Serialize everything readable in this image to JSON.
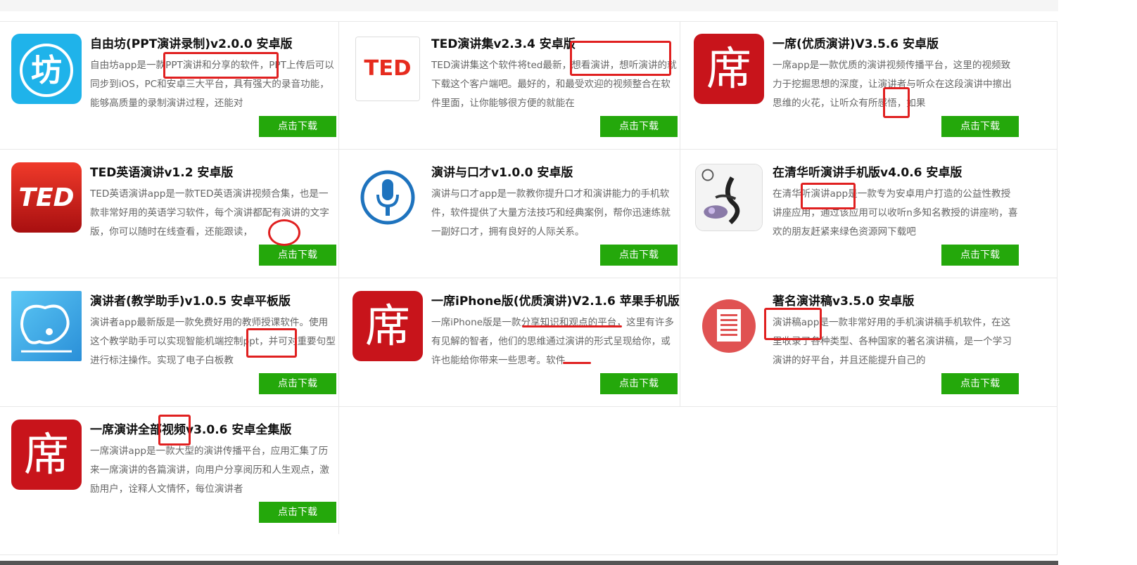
{
  "apps": [
    {
      "title": "自由坊(PPT演讲录制)v2.0.0 安卓版",
      "desc": "自由坊app是一款PPT演讲和分享的软件，PPT上传后可以同步到iOS，PC和安卓三大平台，具有强大的录音功能，能够高质量的录制演讲过程，还能对",
      "icon": "ziyoufang-icon",
      "button": "点击下载"
    },
    {
      "title": "TED演讲集v2.3.4 安卓版",
      "desc": "TED演讲集这个软件将ted最新，想看演讲，想听演讲的就下载这个客户端吧。最好的，和最受欢迎的视频整合在软件里面，让你能够很方便的就能在",
      "icon": "ted-icon",
      "button": "点击下载"
    },
    {
      "title": "一席(优质演讲)V3.5.6 安卓版",
      "desc": "一席app是一款优质的演讲视频传播平台，这里的视频致力于挖掘思想的深度，让演讲者与听众在这段演讲中擦出思维的火花，让听众有所感悟，如果",
      "icon": "yixi-icon",
      "button": "点击下载"
    },
    {
      "title": "TED英语演讲v1.2 安卓版",
      "desc": "TED英语演讲app是一款TED英语演讲视频合集，也是一款非常好用的英语学习软件，每个演讲都配有演讲的文字版，你可以随时在线查看，还能跟读，",
      "icon": "ted-english-icon",
      "button": "点击下载"
    },
    {
      "title": "演讲与口才v1.0.0 安卓版",
      "desc": "演讲与口才app是一款教你提升口才和演讲能力的手机软件，软件提供了大量方法技巧和经典案例，帮你迅速练就一副好口才，拥有良好的人际关系。",
      "icon": "microphone-icon",
      "button": "点击下载"
    },
    {
      "title": "在清华听演讲手机版v4.0.6 安卓版",
      "desc": "在清华听演讲app是一款专为安卓用户打造的公益性教授讲座应用，通过该应用可以收听n多知名教授的讲座哟，喜欢的朋友赶紧来绿色资源网下载吧",
      "icon": "tsinghua-icon",
      "button": "点击下载"
    },
    {
      "title": "演讲者(教学助手)v1.0.5 安卓平板版",
      "desc": "演讲者app最新版是一款免费好用的教师授课软件。使用这个教学助手可以实现智能机端控制ppt，并可对重要句型进行标注操作。实现了电子白板教",
      "icon": "speaker-bubble-icon",
      "button": "点击下载"
    },
    {
      "title": "一席iPhone版(优质演讲)V2.1.6 苹果手机版",
      "desc": "一席iPhone版是一款分享知识和观点的平台，这里有许多有见解的智者，他们的思维通过演讲的形式呈现给你，或许也能给你带来一些思考。软件",
      "icon": "yixi-icon",
      "button": "点击下载"
    },
    {
      "title": "著名演讲稿v3.5.0 安卓版",
      "desc": "演讲稿app是一款非常好用的手机演讲稿手机软件，在这里收录了各种类型、各种国家的著名演讲稿，是一个学习演讲的好平台，并且还能提升自己的",
      "icon": "document-icon",
      "button": "点击下载"
    },
    {
      "title": "一席演讲全部视频v3.0.6 安卓全集版",
      "desc": "一席演讲app是一款大型的演讲传播平台，应用汇集了历来一席演讲的各篇演讲，向用户分享阅历和人生观点，激励用户，诠释人文情怀，每位演讲者",
      "icon": "yixi-icon",
      "button": "点击下载"
    }
  ],
  "icon_glyphs": {
    "ziyoufang": "坊",
    "ted": "TED",
    "yixi": "席"
  },
  "colors": {
    "download_button": "#24a80b",
    "ziyoufang_icon": "#1fb3ea",
    "ted_red": "#e62b1e",
    "yixi_red": "#c8141b",
    "annotation_red": "#e02020"
  }
}
